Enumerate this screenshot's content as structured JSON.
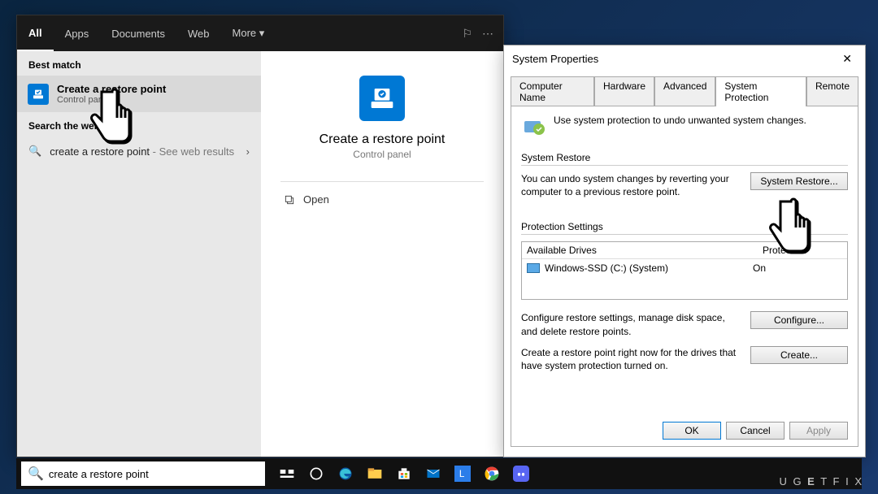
{
  "searchTop": {
    "tabs": [
      "All",
      "Apps",
      "Documents",
      "Web",
      "More ▾"
    ]
  },
  "bestMatch": {
    "header": "Best match",
    "title": "Create a restore point",
    "subtitle": "Control panel"
  },
  "searchWeb": {
    "header": "Search the web",
    "item": "create a restore point",
    "suffix": "- See web results"
  },
  "detail": {
    "title": "Create a restore point",
    "subtitle": "Control panel",
    "open": "Open"
  },
  "sysprop": {
    "title": "System Properties",
    "tabs": [
      "Computer Name",
      "Hardware",
      "Advanced",
      "System Protection",
      "Remote"
    ],
    "infoText": "Use system protection to undo unwanted system changes.",
    "restore": {
      "label": "System Restore",
      "text": "You can undo system changes by reverting your computer to a previous restore point.",
      "btn": "System Restore..."
    },
    "protection": {
      "label": "Protection Settings",
      "colDrives": "Available Drives",
      "colProt": "Protection",
      "driveName": "Windows-SSD (C:) (System)",
      "driveProt": "On",
      "configureText": "Configure restore settings, manage disk space, and delete restore points.",
      "configureBtn": "Configure...",
      "createText": "Create a restore point right now for the drives that have system protection turned on.",
      "createBtn": "Create..."
    },
    "footer": {
      "ok": "OK",
      "cancel": "Cancel",
      "apply": "Apply"
    }
  },
  "taskbar": {
    "searchValue": "create a restore point"
  },
  "watermark": "UGETFIX"
}
